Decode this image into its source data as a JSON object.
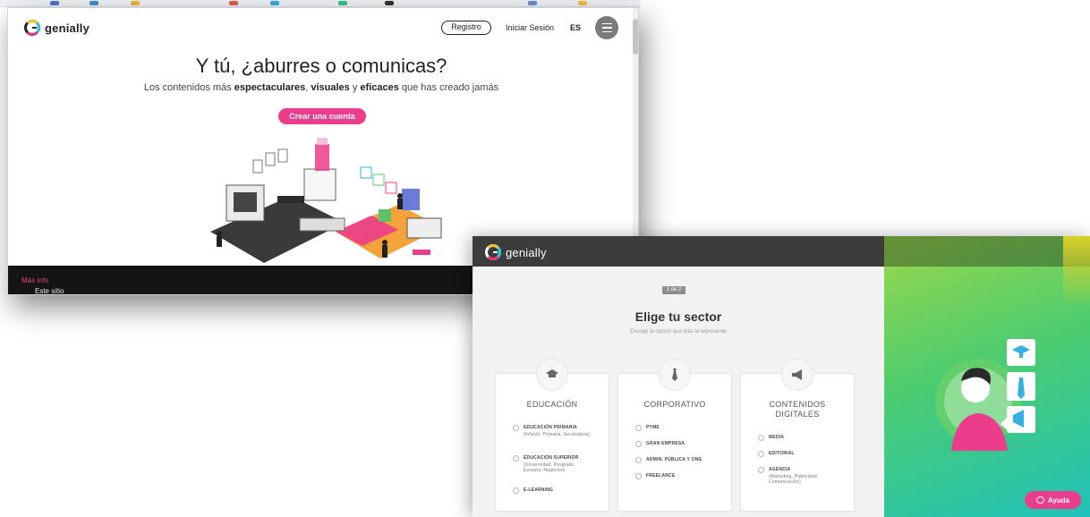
{
  "brand": {
    "name": "genially"
  },
  "landing": {
    "nav": {
      "register_label": "Registro",
      "login_label": "Iniciar Sesión",
      "lang_label": "ES"
    },
    "hero": {
      "title": "Y tú, ¿aburres o comunicas?",
      "sub_prefix": "Los contenidos más ",
      "sub_bold1": "espectaculares",
      "sub_sep1": ", ",
      "sub_bold2": "visuales",
      "sub_sep2": " y ",
      "sub_bold3": "eficaces",
      "sub_suffix": " que has creado jamás",
      "cta_label": "Crear una cuenta"
    },
    "cookie": {
      "text": "Este sitio web utiliza cookies para garantizar que tengas la mejor experiencia en nuestro sitio web. ",
      "link_label": "Más info"
    }
  },
  "onboarding": {
    "step_label": "1 de 2",
    "title": "Elige tu sector",
    "subtitle": "Escoge la opción que más te represente",
    "cards": [
      {
        "title": "EDUCACIÓN",
        "options": [
          {
            "label": "Educación primaria",
            "desc": "(Infantil, Primaria, Secundaria)"
          },
          {
            "label": "Educación superior",
            "desc": "(Universidad, Posgrado, Escuela, Negocios)"
          },
          {
            "label": "E-learning",
            "desc": ""
          }
        ]
      },
      {
        "title": "CORPORATIVO",
        "options": [
          {
            "label": "Pyme",
            "desc": ""
          },
          {
            "label": "Gran empresa",
            "desc": ""
          },
          {
            "label": "Admin. pública y ONG",
            "desc": ""
          },
          {
            "label": "Freelance",
            "desc": ""
          }
        ]
      },
      {
        "title_line1": "CONTENIDOS",
        "title_line2": "DIGITALES",
        "options": [
          {
            "label": "Media",
            "desc": ""
          },
          {
            "label": "Editorial",
            "desc": ""
          },
          {
            "label": "Agencia",
            "desc": "(Marketing, Publicidad, Comunicación)"
          }
        ]
      }
    ],
    "help_label": "Ayuda"
  },
  "colors": {
    "accent": "#ec3d8c",
    "header_dark": "#3c3c3c",
    "cookie_bg": "#141414"
  },
  "icons": [
    "genially-logo",
    "menu-icon",
    "graduation-cap-icon",
    "tie-icon",
    "megaphone-icon",
    "chat-bubble-icon"
  ]
}
